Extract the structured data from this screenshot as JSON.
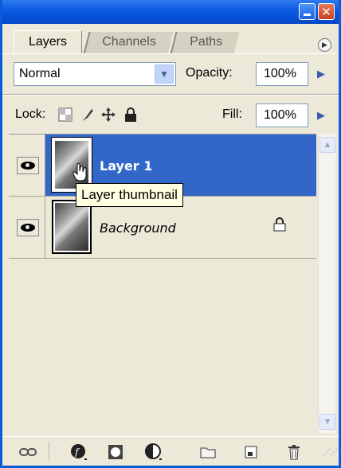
{
  "tabs": [
    {
      "label": "Layers",
      "active": true
    },
    {
      "label": "Channels",
      "active": false
    },
    {
      "label": "Paths",
      "active": false
    }
  ],
  "blend": {
    "mode": "Normal",
    "opacity_label": "Opacity:",
    "opacity_value": "100%"
  },
  "lock": {
    "label": "Lock:",
    "fill_label": "Fill:",
    "fill_value": "100%"
  },
  "layers": [
    {
      "name": "Layer 1",
      "selected": true,
      "visible": true
    },
    {
      "name": "Background",
      "selected": false,
      "visible": true,
      "locked": true
    }
  ],
  "tooltip": "Layer thumbnail",
  "icons": {
    "panel_menu": "triangle-right",
    "lock_transparent": "checkerboard",
    "lock_image": "brush",
    "lock_position": "move-cross",
    "lock_all": "padlock",
    "bottom": [
      "link-icon",
      "layer-style-icon",
      "layer-mask-icon",
      "adjustment-layer-icon",
      "folder-icon",
      "new-layer-icon",
      "trash-icon"
    ]
  },
  "colors": {
    "selection": "#3266C8",
    "title_bar": "#0A5AE0",
    "panel_bg": "#ECE9D8"
  }
}
